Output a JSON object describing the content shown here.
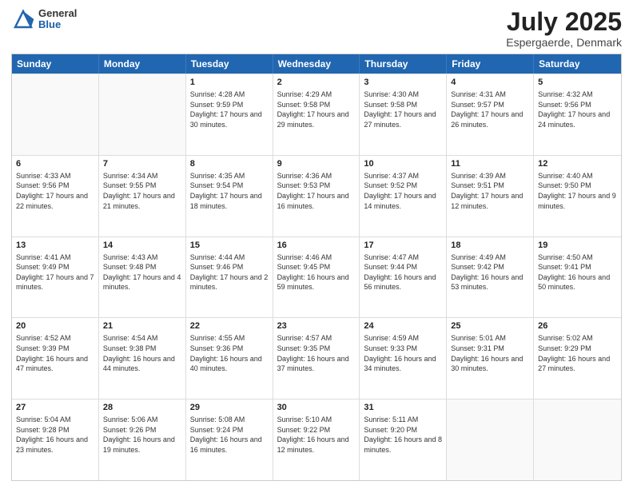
{
  "header": {
    "logo_general": "General",
    "logo_blue": "Blue",
    "title": "July 2025",
    "location": "Espergaerde, Denmark"
  },
  "days_of_week": [
    "Sunday",
    "Monday",
    "Tuesday",
    "Wednesday",
    "Thursday",
    "Friday",
    "Saturday"
  ],
  "weeks": [
    [
      {
        "day": "",
        "sunrise": "",
        "sunset": "",
        "daylight": "",
        "empty": true
      },
      {
        "day": "",
        "sunrise": "",
        "sunset": "",
        "daylight": "",
        "empty": true
      },
      {
        "day": "1",
        "sunrise": "Sunrise: 4:28 AM",
        "sunset": "Sunset: 9:59 PM",
        "daylight": "Daylight: 17 hours and 30 minutes.",
        "empty": false
      },
      {
        "day": "2",
        "sunrise": "Sunrise: 4:29 AM",
        "sunset": "Sunset: 9:58 PM",
        "daylight": "Daylight: 17 hours and 29 minutes.",
        "empty": false
      },
      {
        "day": "3",
        "sunrise": "Sunrise: 4:30 AM",
        "sunset": "Sunset: 9:58 PM",
        "daylight": "Daylight: 17 hours and 27 minutes.",
        "empty": false
      },
      {
        "day": "4",
        "sunrise": "Sunrise: 4:31 AM",
        "sunset": "Sunset: 9:57 PM",
        "daylight": "Daylight: 17 hours and 26 minutes.",
        "empty": false
      },
      {
        "day": "5",
        "sunrise": "Sunrise: 4:32 AM",
        "sunset": "Sunset: 9:56 PM",
        "daylight": "Daylight: 17 hours and 24 minutes.",
        "empty": false
      }
    ],
    [
      {
        "day": "6",
        "sunrise": "Sunrise: 4:33 AM",
        "sunset": "Sunset: 9:56 PM",
        "daylight": "Daylight: 17 hours and 22 minutes.",
        "empty": false
      },
      {
        "day": "7",
        "sunrise": "Sunrise: 4:34 AM",
        "sunset": "Sunset: 9:55 PM",
        "daylight": "Daylight: 17 hours and 21 minutes.",
        "empty": false
      },
      {
        "day": "8",
        "sunrise": "Sunrise: 4:35 AM",
        "sunset": "Sunset: 9:54 PM",
        "daylight": "Daylight: 17 hours and 18 minutes.",
        "empty": false
      },
      {
        "day": "9",
        "sunrise": "Sunrise: 4:36 AM",
        "sunset": "Sunset: 9:53 PM",
        "daylight": "Daylight: 17 hours and 16 minutes.",
        "empty": false
      },
      {
        "day": "10",
        "sunrise": "Sunrise: 4:37 AM",
        "sunset": "Sunset: 9:52 PM",
        "daylight": "Daylight: 17 hours and 14 minutes.",
        "empty": false
      },
      {
        "day": "11",
        "sunrise": "Sunrise: 4:39 AM",
        "sunset": "Sunset: 9:51 PM",
        "daylight": "Daylight: 17 hours and 12 minutes.",
        "empty": false
      },
      {
        "day": "12",
        "sunrise": "Sunrise: 4:40 AM",
        "sunset": "Sunset: 9:50 PM",
        "daylight": "Daylight: 17 hours and 9 minutes.",
        "empty": false
      }
    ],
    [
      {
        "day": "13",
        "sunrise": "Sunrise: 4:41 AM",
        "sunset": "Sunset: 9:49 PM",
        "daylight": "Daylight: 17 hours and 7 minutes.",
        "empty": false
      },
      {
        "day": "14",
        "sunrise": "Sunrise: 4:43 AM",
        "sunset": "Sunset: 9:48 PM",
        "daylight": "Daylight: 17 hours and 4 minutes.",
        "empty": false
      },
      {
        "day": "15",
        "sunrise": "Sunrise: 4:44 AM",
        "sunset": "Sunset: 9:46 PM",
        "daylight": "Daylight: 17 hours and 2 minutes.",
        "empty": false
      },
      {
        "day": "16",
        "sunrise": "Sunrise: 4:46 AM",
        "sunset": "Sunset: 9:45 PM",
        "daylight": "Daylight: 16 hours and 59 minutes.",
        "empty": false
      },
      {
        "day": "17",
        "sunrise": "Sunrise: 4:47 AM",
        "sunset": "Sunset: 9:44 PM",
        "daylight": "Daylight: 16 hours and 56 minutes.",
        "empty": false
      },
      {
        "day": "18",
        "sunrise": "Sunrise: 4:49 AM",
        "sunset": "Sunset: 9:42 PM",
        "daylight": "Daylight: 16 hours and 53 minutes.",
        "empty": false
      },
      {
        "day": "19",
        "sunrise": "Sunrise: 4:50 AM",
        "sunset": "Sunset: 9:41 PM",
        "daylight": "Daylight: 16 hours and 50 minutes.",
        "empty": false
      }
    ],
    [
      {
        "day": "20",
        "sunrise": "Sunrise: 4:52 AM",
        "sunset": "Sunset: 9:39 PM",
        "daylight": "Daylight: 16 hours and 47 minutes.",
        "empty": false
      },
      {
        "day": "21",
        "sunrise": "Sunrise: 4:54 AM",
        "sunset": "Sunset: 9:38 PM",
        "daylight": "Daylight: 16 hours and 44 minutes.",
        "empty": false
      },
      {
        "day": "22",
        "sunrise": "Sunrise: 4:55 AM",
        "sunset": "Sunset: 9:36 PM",
        "daylight": "Daylight: 16 hours and 40 minutes.",
        "empty": false
      },
      {
        "day": "23",
        "sunrise": "Sunrise: 4:57 AM",
        "sunset": "Sunset: 9:35 PM",
        "daylight": "Daylight: 16 hours and 37 minutes.",
        "empty": false
      },
      {
        "day": "24",
        "sunrise": "Sunrise: 4:59 AM",
        "sunset": "Sunset: 9:33 PM",
        "daylight": "Daylight: 16 hours and 34 minutes.",
        "empty": false
      },
      {
        "day": "25",
        "sunrise": "Sunrise: 5:01 AM",
        "sunset": "Sunset: 9:31 PM",
        "daylight": "Daylight: 16 hours and 30 minutes.",
        "empty": false
      },
      {
        "day": "26",
        "sunrise": "Sunrise: 5:02 AM",
        "sunset": "Sunset: 9:29 PM",
        "daylight": "Daylight: 16 hours and 27 minutes.",
        "empty": false
      }
    ],
    [
      {
        "day": "27",
        "sunrise": "Sunrise: 5:04 AM",
        "sunset": "Sunset: 9:28 PM",
        "daylight": "Daylight: 16 hours and 23 minutes.",
        "empty": false
      },
      {
        "day": "28",
        "sunrise": "Sunrise: 5:06 AM",
        "sunset": "Sunset: 9:26 PM",
        "daylight": "Daylight: 16 hours and 19 minutes.",
        "empty": false
      },
      {
        "day": "29",
        "sunrise": "Sunrise: 5:08 AM",
        "sunset": "Sunset: 9:24 PM",
        "daylight": "Daylight: 16 hours and 16 minutes.",
        "empty": false
      },
      {
        "day": "30",
        "sunrise": "Sunrise: 5:10 AM",
        "sunset": "Sunset: 9:22 PM",
        "daylight": "Daylight: 16 hours and 12 minutes.",
        "empty": false
      },
      {
        "day": "31",
        "sunrise": "Sunrise: 5:11 AM",
        "sunset": "Sunset: 9:20 PM",
        "daylight": "Daylight: 16 hours and 8 minutes.",
        "empty": false
      },
      {
        "day": "",
        "sunrise": "",
        "sunset": "",
        "daylight": "",
        "empty": true
      },
      {
        "day": "",
        "sunrise": "",
        "sunset": "",
        "daylight": "",
        "empty": true
      }
    ]
  ]
}
